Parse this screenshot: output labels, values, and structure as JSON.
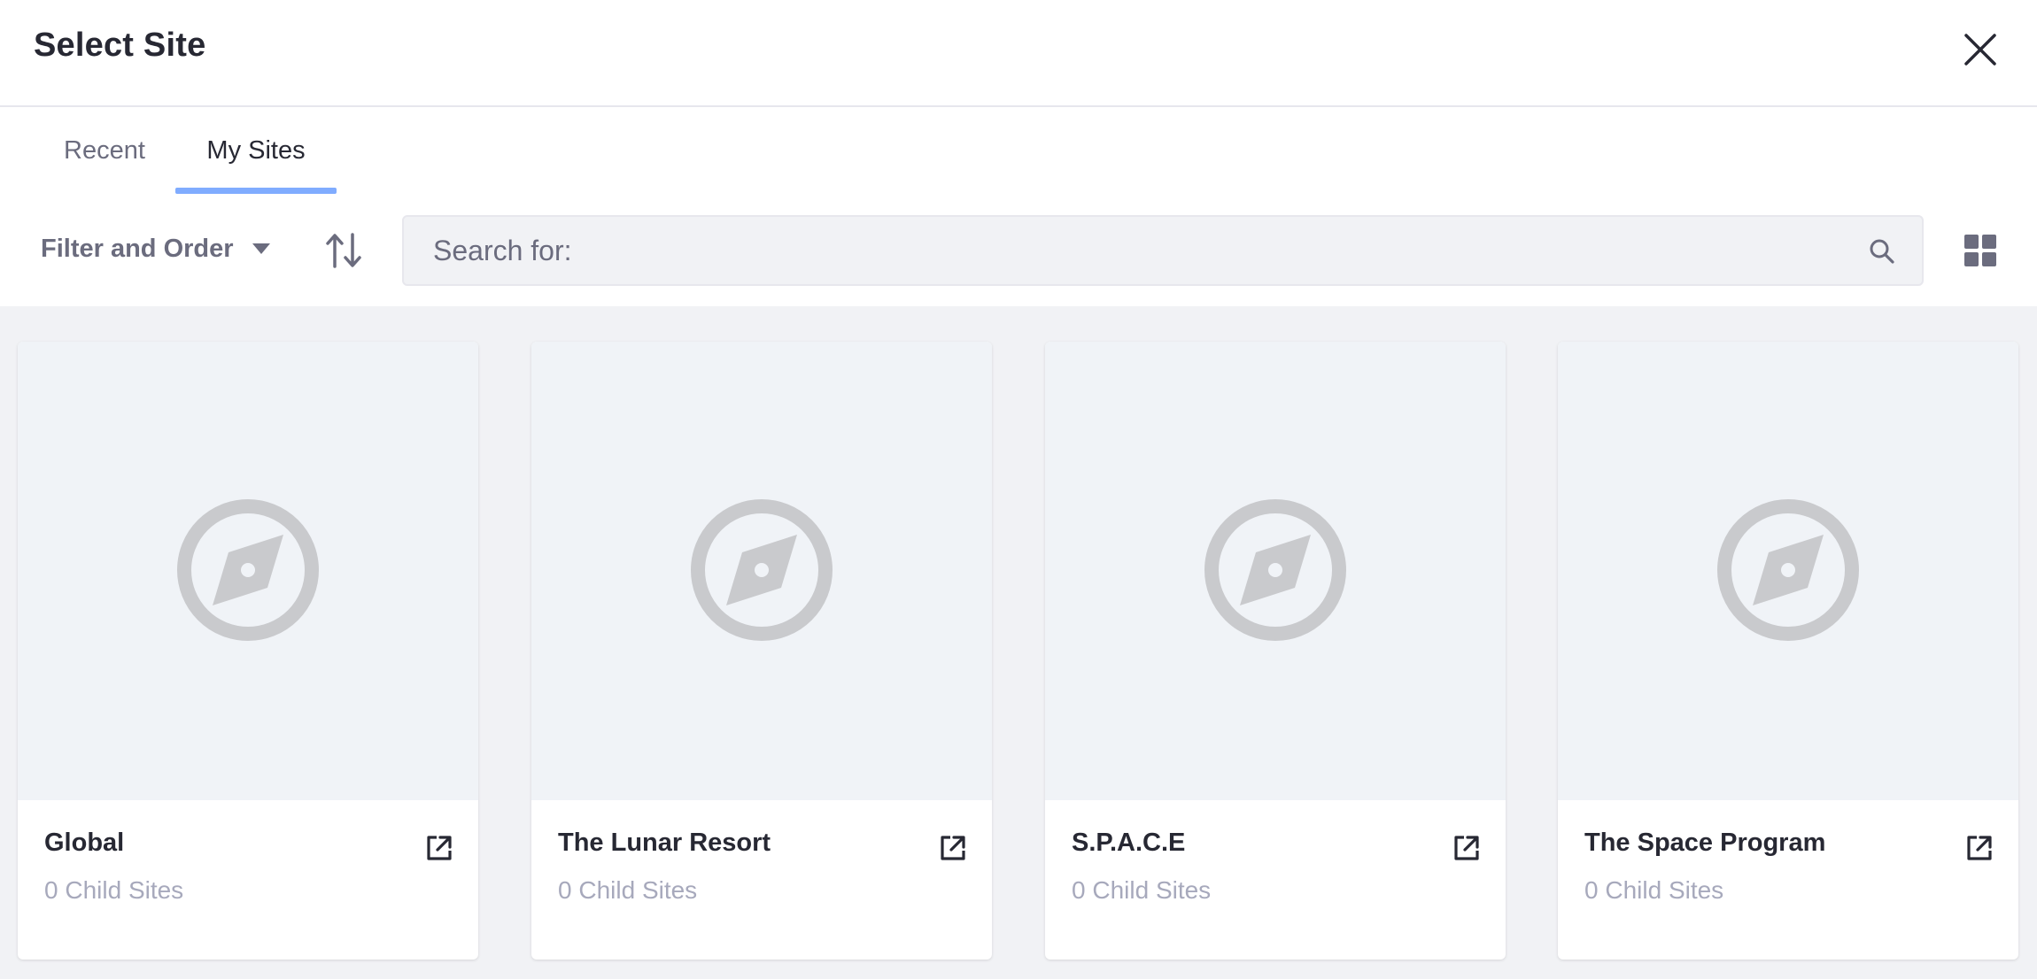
{
  "header": {
    "title": "Select Site"
  },
  "tabs": [
    {
      "label": "Recent",
      "active": false
    },
    {
      "label": "My Sites",
      "active": true
    }
  ],
  "toolbar": {
    "filter_label": "Filter and Order",
    "search_placeholder": "Search for:"
  },
  "sites": [
    {
      "name": "Global",
      "subtitle": "0 Child Sites"
    },
    {
      "name": "The Lunar Resort",
      "subtitle": "0 Child Sites"
    },
    {
      "name": "S.P.A.C.E",
      "subtitle": "0 Child Sites"
    },
    {
      "name": "The Space Program",
      "subtitle": "0 Child Sites"
    }
  ],
  "icons": {
    "close": "close-icon",
    "filter_caret": "caret-down-icon",
    "sort": "order-arrows-icon",
    "search": "search-icon",
    "view": "grid-view-icon",
    "site_placeholder": "compass-icon",
    "open": "external-link-icon"
  },
  "colors": {
    "accent": "#80acff",
    "text_primary": "#272833",
    "text_secondary": "#6b6c7e",
    "text_muted": "#a7a9bc",
    "content_bg": "#f1f2f5",
    "card_image_bg": "#f0f3f7",
    "placeholder_icon": "#c9cacd"
  }
}
